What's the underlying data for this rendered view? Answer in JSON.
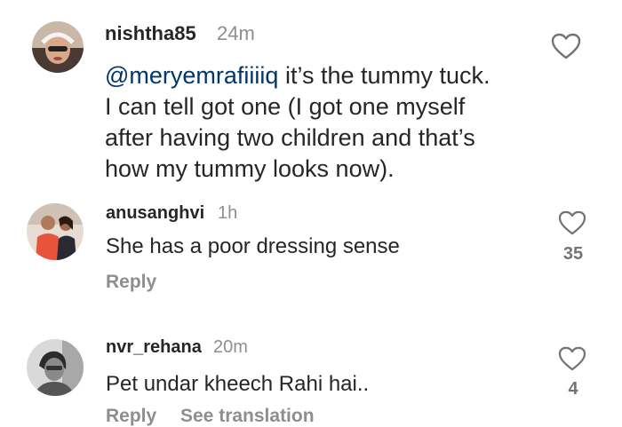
{
  "comments": [
    {
      "username": "nishtha85",
      "time": "24m",
      "mention": "@meryemrafiiiiq",
      "lines": [
        " it’s the tummy tuck.",
        "I can tell got one (I got one myself",
        "after having two children and that’s",
        "how my tummy looks now)."
      ],
      "avatar_icon": "avatar-helmet-photo"
    },
    {
      "username": "anusanghvi",
      "time": "1h",
      "text": "She has a poor dressing sense",
      "likes": "35",
      "reply": "Reply",
      "avatar_icon": "avatar-couple-photo"
    },
    {
      "username": "nvr_rehana",
      "time": "20m",
      "text": "Pet undar kheech Rahi hai..",
      "likes": "4",
      "reply": "Reply",
      "see_translation": "See translation",
      "avatar_icon": "avatar-woman-photo"
    }
  ],
  "colors": {
    "text": "#262626",
    "meta": "#8e8e8e",
    "mention": "#00376b",
    "background": "#ffffff"
  },
  "icons": {
    "like": "heart-outline-icon"
  }
}
